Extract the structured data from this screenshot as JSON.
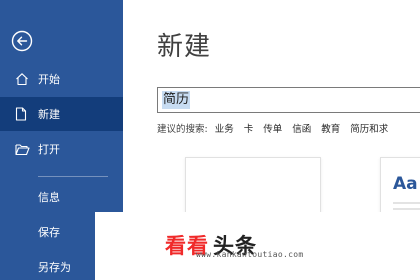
{
  "sidebar": {
    "items": [
      {
        "label": "开始",
        "icon": "home-icon"
      },
      {
        "label": "新建",
        "icon": "new-document-icon",
        "active": true
      },
      {
        "label": "打开",
        "icon": "open-folder-icon"
      },
      {
        "label": "信息"
      },
      {
        "label": "保存"
      },
      {
        "label": "另存为"
      }
    ],
    "back_icon": "back-arrow-icon",
    "colors": {
      "background": "#2b579a",
      "active": "#133d7b"
    }
  },
  "main": {
    "title": "新建",
    "search": {
      "value": "简历"
    },
    "suggested": {
      "label": "建议的搜索:",
      "tags": [
        "业务",
        "卡",
        "传单",
        "信函",
        "教育",
        "简历和求"
      ]
    },
    "templates": [
      {
        "kind": "blank"
      },
      {
        "kind": "theme",
        "preview_text": "Aa"
      }
    ]
  },
  "watermark": {
    "brand_red": "看看",
    "brand_black": "头条",
    "url": "www.kankantoutiao.com",
    "colors": {
      "red": "#f02a2a"
    }
  }
}
